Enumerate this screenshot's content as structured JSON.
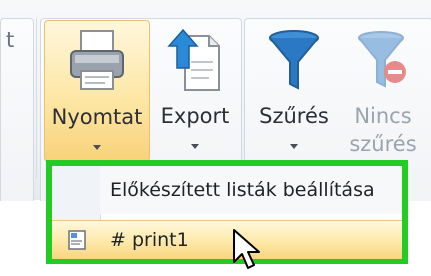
{
  "ribbon": {
    "partial_left_char": "t",
    "buttons": {
      "print": {
        "label": "Nyomtat",
        "icon": "printer-icon"
      },
      "export": {
        "label": "Export",
        "icon": "export-document-icon"
      },
      "filter": {
        "label": "Szűrés",
        "icon": "funnel-icon"
      },
      "no_filter": {
        "label_line1": "Nincs",
        "label_line2": "szűrés",
        "icon": "funnel-remove-icon",
        "disabled": true
      }
    }
  },
  "dropdown": {
    "header": "Előkészített listák beállítása",
    "items": [
      {
        "label": "# print1",
        "icon": "report-icon"
      }
    ],
    "highlight_color": "#22cc22"
  }
}
